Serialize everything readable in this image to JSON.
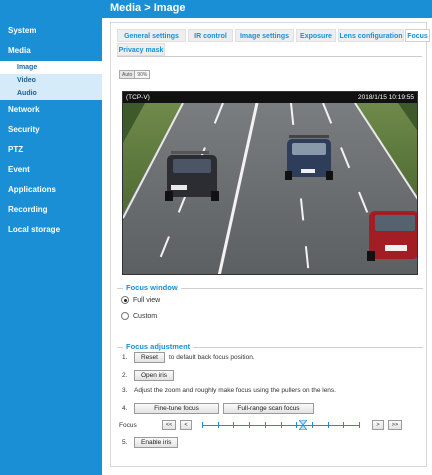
{
  "header": {
    "breadcrumb": "Media > Image"
  },
  "sidebar": {
    "items": [
      {
        "label": "System"
      },
      {
        "label": "Media"
      },
      {
        "label": "Network"
      },
      {
        "label": "Security"
      },
      {
        "label": "PTZ"
      },
      {
        "label": "Event"
      },
      {
        "label": "Applications"
      },
      {
        "label": "Recording"
      },
      {
        "label": "Local storage"
      }
    ],
    "media_subitems": [
      {
        "label": "Image",
        "active": true
      },
      {
        "label": "Video"
      },
      {
        "label": "Audio"
      }
    ]
  },
  "tabs": [
    {
      "label": "General settings"
    },
    {
      "label": "IR control"
    },
    {
      "label": "Image settings"
    },
    {
      "label": "Exposure"
    },
    {
      "label": "Lens configuration"
    },
    {
      "label": "Focus",
      "active": true
    },
    {
      "label": "Privacy mask"
    }
  ],
  "mode_toggle": {
    "auto": "Auto",
    "ratio": "90%"
  },
  "video": {
    "label": "(TCP-V)",
    "timestamp": "2018/1/15 10:19:55"
  },
  "focus_window": {
    "title": "Focus window",
    "options": [
      {
        "label": "Full view",
        "checked": true
      },
      {
        "label": "Custom",
        "checked": false
      }
    ]
  },
  "focus_adjustment": {
    "title": "Focus adjustment",
    "step1": {
      "num": "1.",
      "button": "Reset",
      "text": "to default back focus position."
    },
    "step2": {
      "num": "2.",
      "button": "Open iris"
    },
    "step3": {
      "num": "3.",
      "text": "Adjust the zoom and roughly make focus using the pullers on the lens."
    },
    "step4": {
      "num": "4.",
      "button_fine": "Fine-tune focus",
      "button_full": "Full-range scan focus"
    },
    "focus": {
      "label": "Focus",
      "btn_far_left": "<<",
      "btn_left": "<",
      "btn_right": ">",
      "btn_far_right": ">>",
      "position": 0.64,
      "ticks": 10
    },
    "step5": {
      "num": "5.",
      "button": "Enable iris"
    }
  },
  "colors": {
    "accent": "#1a8fd6",
    "sidebar_sub": "#d5ebf9"
  }
}
